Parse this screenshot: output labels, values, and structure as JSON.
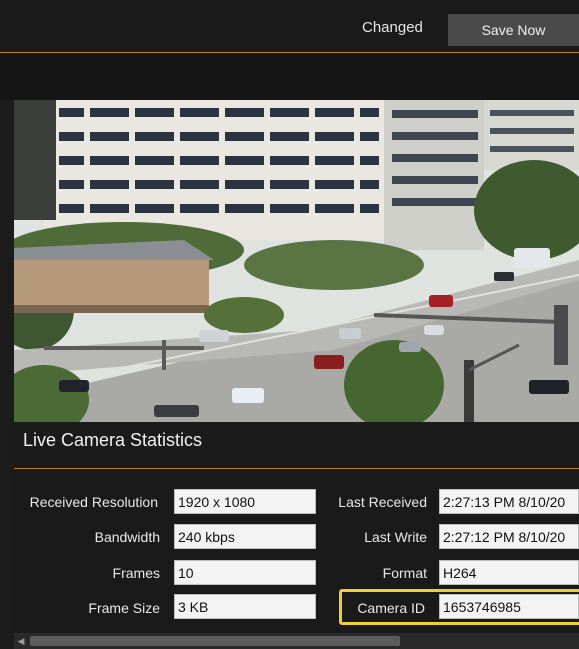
{
  "header": {
    "status_text": "Changed",
    "save_label": "Save Now"
  },
  "camera": {
    "image_name": "live-camera-feed-image"
  },
  "section": {
    "title": "Live Camera Statistics"
  },
  "stats": {
    "received_resolution": {
      "label": "Received Resolution",
      "value": "1920 x 1080"
    },
    "bandwidth": {
      "label": "Bandwidth",
      "value": "240 kbps"
    },
    "frames": {
      "label": "Frames",
      "value": "10"
    },
    "frame_size": {
      "label": "Frame Size",
      "value": "3 KB"
    },
    "last_received": {
      "label": "Last Received",
      "value": "2:27:13 PM 8/10/20"
    },
    "last_write": {
      "label": "Last Write",
      "value": "2:27:12 PM 8/10/20"
    },
    "format": {
      "label": "Format",
      "value": "H264"
    },
    "camera_id": {
      "label": "Camera ID",
      "value": "1653746985"
    }
  },
  "colors": {
    "accent": "#c67a22",
    "highlight": "#f0d030",
    "background": "#1c1c1c"
  }
}
